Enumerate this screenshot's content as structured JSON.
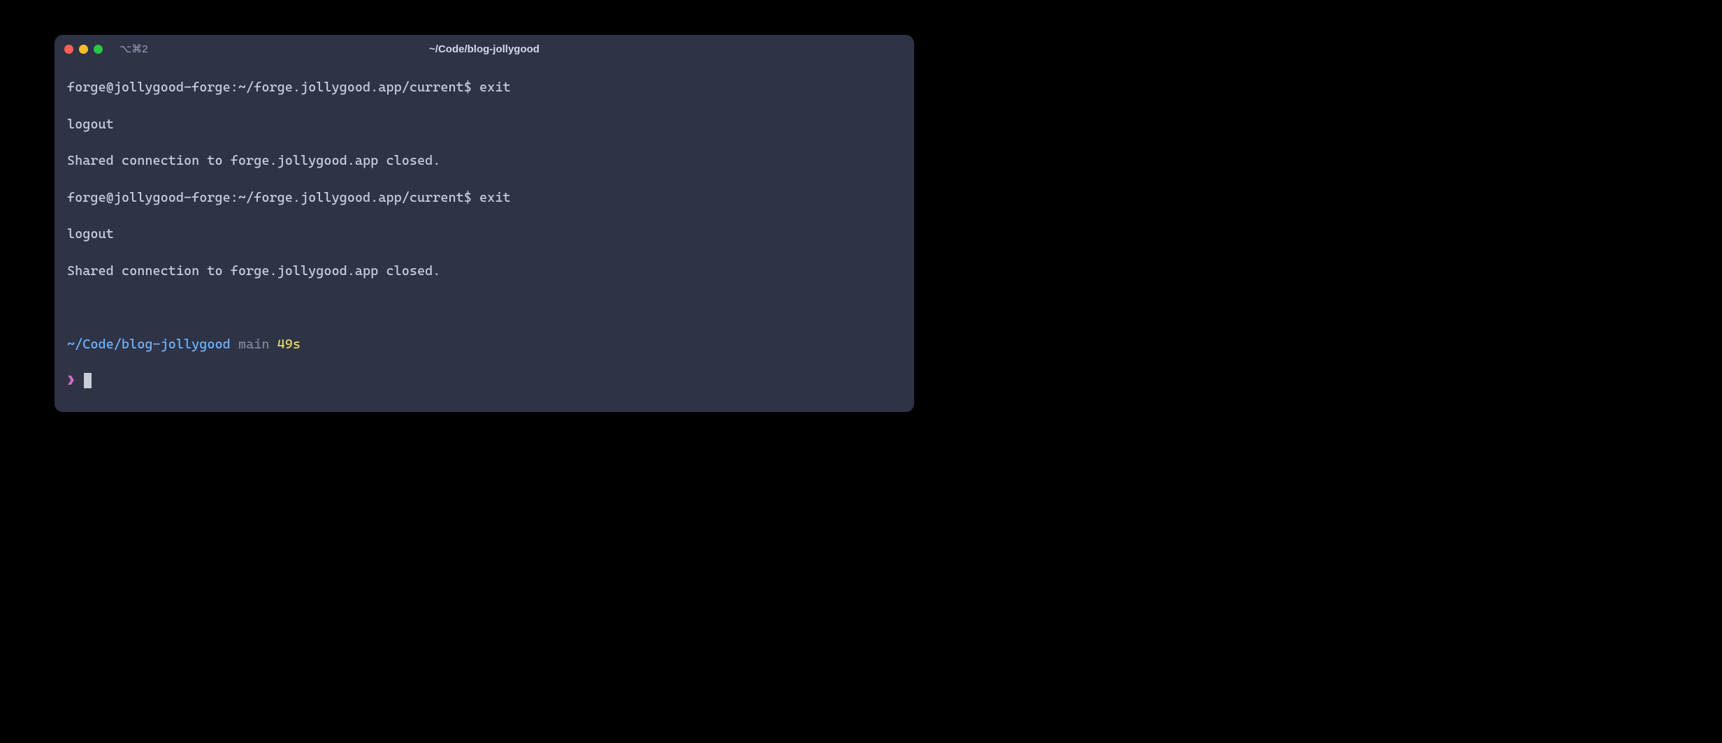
{
  "window": {
    "tab_label": "⌥⌘2",
    "title": "~/Code/blog-jollygood"
  },
  "lines": {
    "l1_prompt": "forge@jollygood-forge:~/forge.jollygood.app/current$ ",
    "l1_cmd": "exit",
    "l2": "logout",
    "l3": "Shared connection to forge.jollygood.app closed.",
    "l4_prompt": "forge@jollygood-forge:~/forge.jollygood.app/current$ ",
    "l4_cmd": "exit",
    "l5": "logout",
    "l6": "Shared connection to forge.jollygood.app closed."
  },
  "prompt": {
    "path": "~/Code/blog-jollygood",
    "branch": "main",
    "time": "49s",
    "chevron": "❯"
  }
}
